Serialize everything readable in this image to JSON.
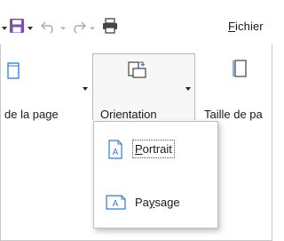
{
  "toolbar": {
    "fichier_prefix": "F",
    "fichier_rest": "ichier",
    "save_icon": "save-icon",
    "undo_icon": "undo-icon",
    "redo_icon": "redo-icon",
    "print_icon": "print-icon"
  },
  "ribbon": {
    "left_label": "de la page",
    "orientation_label": "Orientation",
    "right_label": "Taille de pa"
  },
  "menu": {
    "items": [
      {
        "u": "P",
        "rest": "ortrait",
        "icon": "portrait-page-icon"
      },
      {
        "pre": "Pa",
        "u": "y",
        "rest": "sage",
        "icon": "landscape-page-icon"
      }
    ]
  },
  "colors": {
    "save_purple": "#7a4fb0",
    "icon_blue": "#2b7fd6",
    "text": "#1a1a1a"
  }
}
